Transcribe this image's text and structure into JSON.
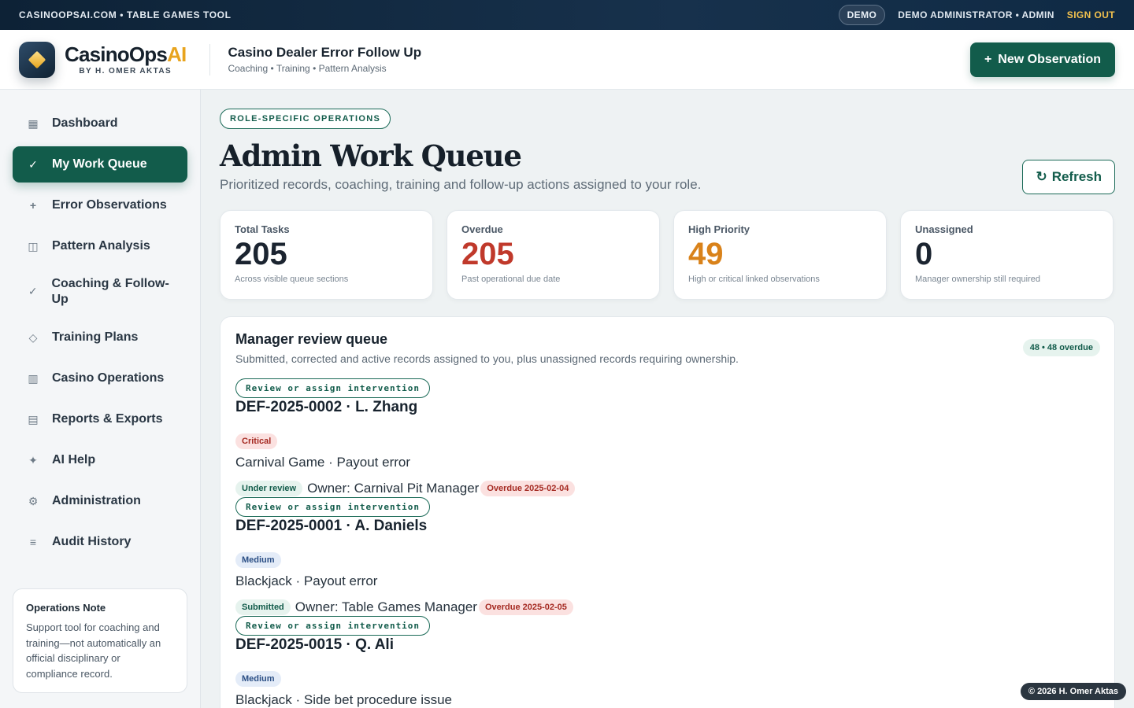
{
  "topbar": {
    "brand_line": "CASINOOPSAI.COM • TABLE GAMES TOOL",
    "demo_label": "DEMO",
    "user_label": "DEMO ADMINISTRATOR • ADMIN",
    "signout_label": "SIGN OUT"
  },
  "header": {
    "brand_name_main": "CasinoOps",
    "brand_name_accent": "AI",
    "brand_byline": "BY H. OMER AKTAS",
    "title": "Casino Dealer Error Follow Up",
    "subtitle": "Coaching • Training • Pattern Analysis",
    "new_button_label": "New Observation",
    "new_button_icon": "plus-icon"
  },
  "sidebar": {
    "items": [
      {
        "label": "Dashboard",
        "icon": "grid-icon",
        "glyph": "▦"
      },
      {
        "label": "My Work Queue",
        "icon": "check-icon",
        "glyph": "✓"
      },
      {
        "label": "Error Observations",
        "icon": "plus-icon",
        "glyph": "+"
      },
      {
        "label": "Pattern Analysis",
        "icon": "columns-icon",
        "glyph": "◫"
      },
      {
        "label": "Coaching & Follow-Up",
        "icon": "check-icon",
        "glyph": "✓"
      },
      {
        "label": "Training Plans",
        "icon": "diamond-icon",
        "glyph": "◇"
      },
      {
        "label": "Casino Operations",
        "icon": "building-icon",
        "glyph": "▥"
      },
      {
        "label": "Reports & Exports",
        "icon": "report-icon",
        "glyph": "▤"
      },
      {
        "label": "AI Help",
        "icon": "sparkle-icon",
        "glyph": "✦"
      },
      {
        "label": "Administration",
        "icon": "gear-icon",
        "glyph": "⚙"
      },
      {
        "label": "Audit History",
        "icon": "list-icon",
        "glyph": "≡"
      }
    ],
    "note": {
      "heading": "Operations Note",
      "body": "Support tool for coaching and training—not automatically an official disciplinary or compliance record."
    }
  },
  "main": {
    "eyebrow": "ROLE-SPECIFIC OPERATIONS",
    "title": "Admin Work Queue",
    "description": "Prioritized records, coaching, training and follow-up actions assigned to your role.",
    "refresh_label": "Refresh",
    "stats": [
      {
        "label": "Total Tasks",
        "value": "205",
        "note": "Across visible queue sections",
        "color": "#1b2430"
      },
      {
        "label": "Overdue",
        "value": "205",
        "note": "Past operational due date",
        "color": "#c0392b"
      },
      {
        "label": "High Priority",
        "value": "49",
        "note": "High or critical linked observations",
        "color": "#d9821a"
      },
      {
        "label": "Unassigned",
        "value": "0",
        "note": "Manager ownership still required",
        "color": "#1b2430"
      }
    ],
    "queue": {
      "title": "Manager review queue",
      "description": "Submitted, corrected and active records assigned to you, plus unassigned records requiring ownership.",
      "badge": "48 • 48 overdue",
      "records": [
        {
          "action": "Review or assign intervention",
          "id_line": "DEF-2025-0002 · L. Zhang",
          "severity": "Critical",
          "game_line": "Carnival Game · Payout error",
          "status": "Under review",
          "owner": "Owner: Carnival Pit Manager",
          "due": "Overdue 2025-02-04"
        },
        {
          "action": "Review or assign intervention",
          "id_line": "DEF-2025-0001 · A. Daniels",
          "severity": "Medium",
          "game_line": "Blackjack · Payout error",
          "status": "Submitted",
          "owner": "Owner: Table Games Manager",
          "due": "Overdue 2025-02-05"
        },
        {
          "action": "Review or assign intervention",
          "id_line": "DEF-2025-0015 · Q. Ali",
          "severity": "Medium",
          "game_line": "Blackjack · Side bet procedure issue"
        }
      ]
    }
  },
  "footer": {
    "copyright": "© 2026 H. Omer Aktas"
  },
  "colors": {
    "accent": "#125c4b",
    "brand_gold": "#e8a41e",
    "topbar": "#0d2236",
    "danger": "#c0392b",
    "warning": "#d9821a"
  }
}
